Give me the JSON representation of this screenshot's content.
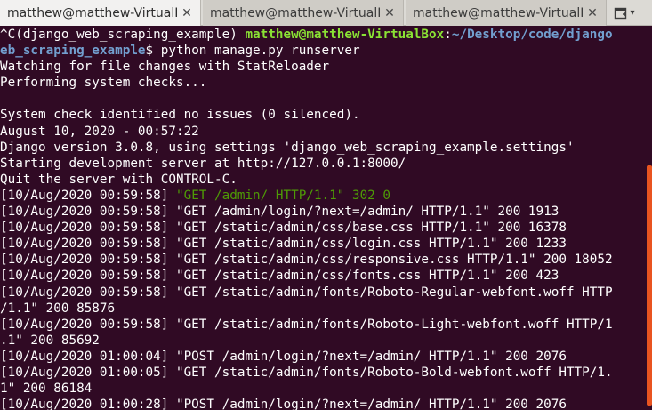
{
  "tabs": [
    {
      "label": "matthew@matthew-VirtualBox: ~/Desktop/code/django_web_scraping_example",
      "close": "✕",
      "active": true
    },
    {
      "label": "matthew@matthew-VirtualBox: ~/Desktop",
      "close": "✕",
      "active": false
    },
    {
      "label": "matthew@matthew-VirtualBox: ~",
      "close": "✕",
      "active": false
    }
  ],
  "new_tab_icon": "new-tab-icon",
  "colors": {
    "background": "#300a24",
    "prompt_user": "#8ae234",
    "prompt_path": "#7faad8",
    "log_green": "#4e9a06",
    "scroll_thumb": "#e95420"
  },
  "terminal": {
    "prompt_prefix": "^C(django_web_scraping_example) ",
    "prompt_user": "matthew@matthew-VirtualBox",
    "prompt_colon": ":",
    "prompt_path_1": "~/Desktop/code/django",
    "prompt_path_2": "eb_scraping_example",
    "prompt_dollar": "$ ",
    "command": "python manage.py runserver",
    "lines": [
      "Watching for file changes with StatReloader",
      "Performing system checks...",
      "",
      "System check identified no issues (0 silenced).",
      "August 10, 2020 - 00:57:22",
      "Django version 3.0.8, using settings 'django_web_scraping_example.settings'",
      "Starting development server at http://127.0.0.1:8000/",
      "Quit the server with CONTROL-C."
    ],
    "first_log_prefix": "[10/Aug/2020 00:59:58] ",
    "first_log_green": "\"GET /admin/ HTTP/1.1\" 302 0",
    "log_lines": [
      "[10/Aug/2020 00:59:58] \"GET /admin/login/?next=/admin/ HTTP/1.1\" 200 1913",
      "[10/Aug/2020 00:59:58] \"GET /static/admin/css/base.css HTTP/1.1\" 200 16378",
      "[10/Aug/2020 00:59:58] \"GET /static/admin/css/login.css HTTP/1.1\" 200 1233",
      "[10/Aug/2020 00:59:58] \"GET /static/admin/css/responsive.css HTTP/1.1\" 200 18052",
      "[10/Aug/2020 00:59:58] \"GET /static/admin/css/fonts.css HTTP/1.1\" 200 423",
      "[10/Aug/2020 00:59:58] \"GET /static/admin/fonts/Roboto-Regular-webfont.woff HTTP",
      "/1.1\" 200 85876",
      "[10/Aug/2020 00:59:58] \"GET /static/admin/fonts/Roboto-Light-webfont.woff HTTP/1",
      ".1\" 200 85692",
      "[10/Aug/2020 01:00:04] \"POST /admin/login/?next=/admin/ HTTP/1.1\" 200 2076",
      "[10/Aug/2020 01:00:05] \"GET /static/admin/fonts/Roboto-Bold-webfont.woff HTTP/1.",
      "1\" 200 86184",
      "[10/Aug/2020 01:00:28] \"POST /admin/login/?next=/admin/ HTTP/1.1\" 200 2076"
    ]
  }
}
